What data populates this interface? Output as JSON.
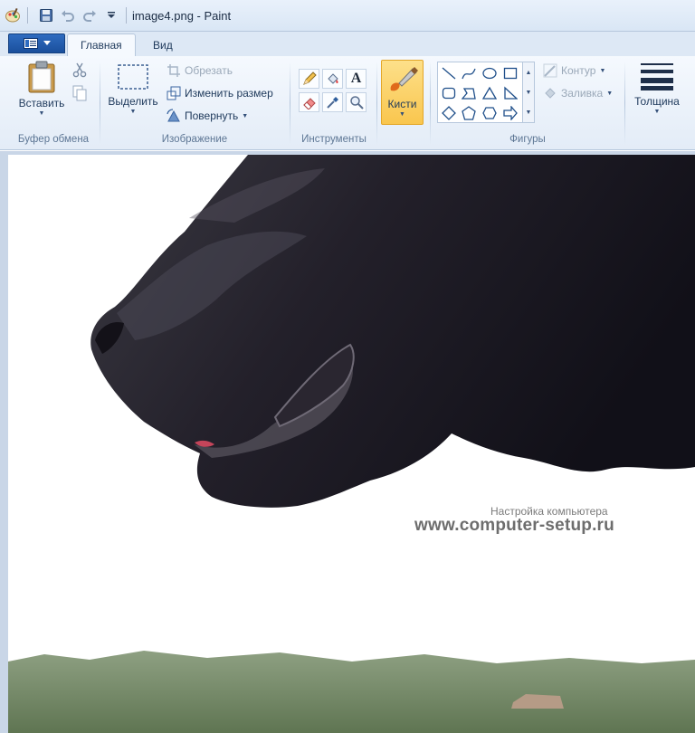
{
  "window": {
    "title": "image4.png - Paint"
  },
  "qat": {
    "app_icon": "paint-app-icon",
    "save_icon": "save-icon",
    "undo_icon": "undo-icon",
    "redo_icon": "redo-icon",
    "customize_icon": "dropdown-caret-icon"
  },
  "tabs": [
    {
      "label": "Главная",
      "active": true
    },
    {
      "label": "Вид",
      "active": false
    }
  ],
  "ribbon": {
    "clipboard": {
      "group_label": "Буфер обмена",
      "paste_label": "Вставить",
      "cut_icon": "scissors-icon",
      "copy_icon": "copy-icon"
    },
    "image": {
      "group_label": "Изображение",
      "select_label": "Выделить",
      "crop_label": "Обрезать",
      "resize_label": "Изменить размер",
      "rotate_label": "Повернуть"
    },
    "tools": {
      "group_label": "Инструменты",
      "items": [
        "pencil-icon",
        "fill-bucket-icon",
        "text-icon",
        "eraser-icon",
        "color-picker-icon",
        "magnifier-icon"
      ],
      "text_glyph": "A"
    },
    "brushes": {
      "label": "Кисти"
    },
    "shapes": {
      "group_label": "Фигуры",
      "outline_label": "Контур",
      "fill_label": "Заливка"
    },
    "thickness": {
      "label": "Толщина"
    }
  },
  "canvas": {
    "watermark_small": "Настройка компьютера",
    "watermark_big": "www.computer-setup.ru"
  },
  "colors": {
    "accent": "#f9c64e",
    "app_menu": "#1a4f9c",
    "ribbon_bg": "#e3ecf7"
  }
}
